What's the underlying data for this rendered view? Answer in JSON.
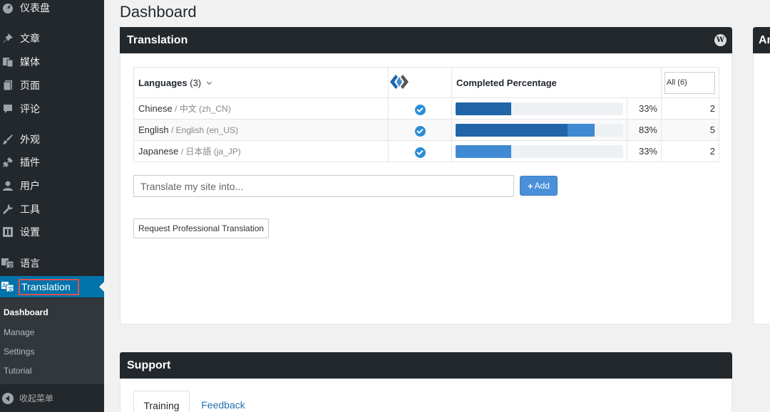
{
  "sidebar": {
    "items": [
      {
        "label": "仪表盘",
        "icon": "dashboard-icon"
      },
      {
        "label": "文章",
        "icon": "pin-icon"
      },
      {
        "label": "媒体",
        "icon": "media-icon"
      },
      {
        "label": "页面",
        "icon": "page-icon"
      },
      {
        "label": "评论",
        "icon": "comment-icon"
      },
      {
        "label": "外观",
        "icon": "paintbrush-icon"
      },
      {
        "label": "插件",
        "icon": "plugin-icon"
      },
      {
        "label": "用户",
        "icon": "user-icon"
      },
      {
        "label": "工具",
        "icon": "wrench-icon"
      },
      {
        "label": "设置",
        "icon": "settings-icon"
      },
      {
        "label": "语言",
        "icon": "language-icon"
      },
      {
        "label": "Translation",
        "icon": "translation-icon"
      }
    ],
    "submenu": [
      "Dashboard",
      "Manage",
      "Settings",
      "Tutorial"
    ],
    "collapse_label": "收起菜单"
  },
  "page": {
    "title": "Dashboard"
  },
  "translation_panel": {
    "title": "Translation",
    "table": {
      "header_languages": "Languages",
      "header_count": "(3)",
      "header_completed": "Completed Percentage",
      "filter_label": "All (6)",
      "rows": [
        {
          "name": "Chinese",
          "sub": " / 中文 (zh_CN)",
          "percent_text": "33%",
          "percent": 33,
          "count": "2"
        },
        {
          "name": "English",
          "sub": " / English (en_US)",
          "percent_text": "83%",
          "percent": 83,
          "count": "5"
        },
        {
          "name": "Japanese",
          "sub": " / 日本語 (ja_JP)",
          "percent_text": "33%",
          "percent": 33,
          "count": "2"
        }
      ]
    },
    "input_placeholder": "Translate my site into...",
    "add_label": "Add",
    "request_label": "Request Professional Translation"
  },
  "right_panel": {
    "title": "An"
  },
  "support_panel": {
    "title": "Support",
    "tabs": [
      "Training",
      "Feedback"
    ]
  },
  "colors": {
    "sidebar": "#23282d",
    "active": "#0073aa",
    "bar_dark": "#1f65a8",
    "bar_light": "#3f8ad3"
  }
}
